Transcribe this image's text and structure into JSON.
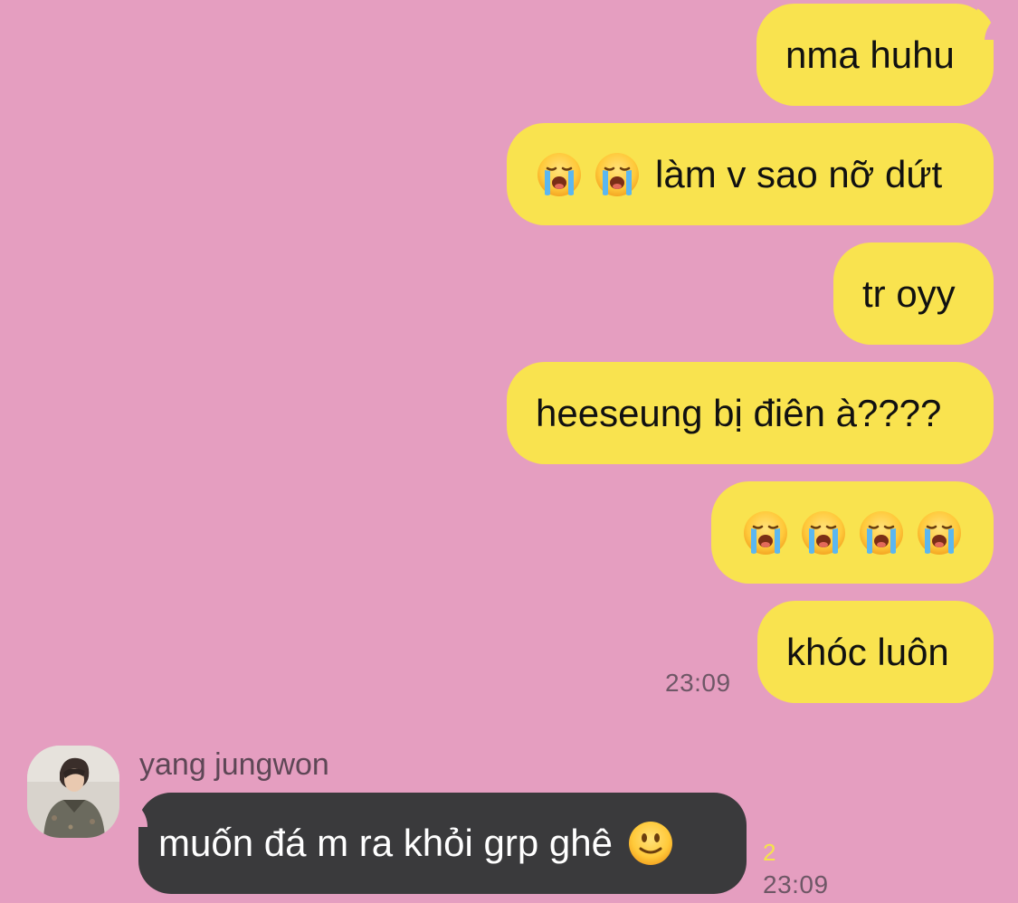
{
  "colors": {
    "background": "#E59EC0",
    "outgoing_bubble": "#F9E34F",
    "incoming_bubble": "#3A3A3C",
    "unread_count": "#F5E44A"
  },
  "messages_out": [
    {
      "text": "nma huhu"
    },
    {
      "emojis": [
        "loudly-crying-face",
        "loudly-crying-face"
      ],
      "text": "làm v sao nỡ dứt"
    },
    {
      "text": "tr oyy"
    },
    {
      "text": "heeseung bị điên à????"
    },
    {
      "emojis": [
        "loudly-crying-face",
        "loudly-crying-face",
        "loudly-crying-face",
        "loudly-crying-face"
      ],
      "text": ""
    },
    {
      "text": "khóc luôn"
    }
  ],
  "out_timestamp": "23:09",
  "incoming": {
    "sender": "yang jungwon",
    "text": "muốn đá m ra khỏi grp ghê",
    "emoji": "slightly-smiling-face",
    "unread_count": "2",
    "timestamp": "23:09"
  }
}
